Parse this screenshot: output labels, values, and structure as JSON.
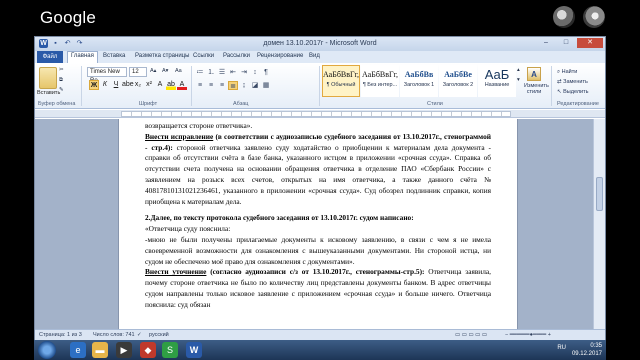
{
  "overlay": {
    "brand": "Google"
  },
  "window": {
    "title": "домен 13.10.2017г - Microsoft Word",
    "controls": {
      "minimize": "–",
      "maximize": "□",
      "close": "✕"
    }
  },
  "tabs": {
    "file": "Файл",
    "items": [
      "Главная",
      "Вставка",
      "Разметка страницы",
      "Ссылки",
      "Рассылки",
      "Рецензирование",
      "Вид"
    ],
    "active_index": 0
  },
  "ribbon": {
    "clipboard": {
      "paste": "Вставить",
      "label": "Буфер обмена"
    },
    "font": {
      "name": "Times New Ro",
      "size": "12",
      "label": "Шрифт"
    },
    "paragraph": {
      "label": "Абзац"
    },
    "styles": {
      "label": "Стили",
      "tiles": [
        {
          "preview": "АаБбВвГг,",
          "name": "¶ Обычный",
          "selected": true
        },
        {
          "preview": "АаБбВвГг,",
          "name": "¶ Без интер...",
          "selected": false
        },
        {
          "preview": "АаБбВв",
          "name": "Заголовок 1",
          "selected": false
        },
        {
          "preview": "АаБбВе",
          "name": "Заголовок 2",
          "selected": false
        },
        {
          "preview": "АаБ",
          "name": "Название",
          "selected": false
        }
      ],
      "change": "Изменить стили"
    },
    "editing": {
      "find": "Найти",
      "replace": "Заменить",
      "select": "Выделить",
      "label": "Редактирование"
    }
  },
  "document": {
    "paragraphs": [
      {
        "type": "plain",
        "text": "возвращается стороне ответчика»."
      },
      {
        "type": "mixed",
        "bold_underline": "Внести исправление",
        "bold": " (в соответствии с аудиозаписью судебного заседания от 13.10.2017г., стенограммой - стр.4):",
        "rest": " стороной ответчика заявлено суду ходатайство о приобщении к материалам дела документа - справки об отсутствии счёта в базе банка, указанного истцом в приложении «срочная ссуда». Справка об отсутствии счета получена на основании обращения ответчика в отделение ПАО «Сбербанк России» с заявлением на розыск всех счетов, открытых на имя ответчика, а также данного счёта № 40817810131021236461, указанного в приложении «срочная ссуда». Суд обозрел подлинник справки, копия приобщена к материалам дела."
      },
      {
        "type": "gap"
      },
      {
        "type": "bold",
        "text": "2.Далее, по тексту протокола судебного заседания от 13.10.2017г. судом написано:"
      },
      {
        "type": "plain",
        "text": "«Ответчица суду пояснила:"
      },
      {
        "type": "plain",
        "text": "-мною не были получены прилагаемые документы к исковому заявлению, в связи с чем я не имела своевременной возможности для ознакомления с вышеуказанными документами. Ни стороной истца, ни судом не обеспечено моё право для ознакомления с документами»."
      },
      {
        "type": "mixed",
        "bold_underline": "Внести уточнение",
        "bold": " (согласно аудиозаписи с/з от 13.10.2017г., стенограммы-стр.5):",
        "rest": " Ответчица заявила, почему стороне ответчика не было по количеству лиц представлены документы банком. В адрес ответчицы судом направлены только исковое заявление с приложением «срочная ссуда» и больше ничего. Ответчица пояснила: суд обязан"
      }
    ]
  },
  "statusbar": {
    "page": "Страница: 1 из 3",
    "words": "Число слов: 741",
    "lang": "русский"
  },
  "taskbar": {
    "lang": "RU",
    "time": "0:35",
    "date": "09.12.2017"
  }
}
